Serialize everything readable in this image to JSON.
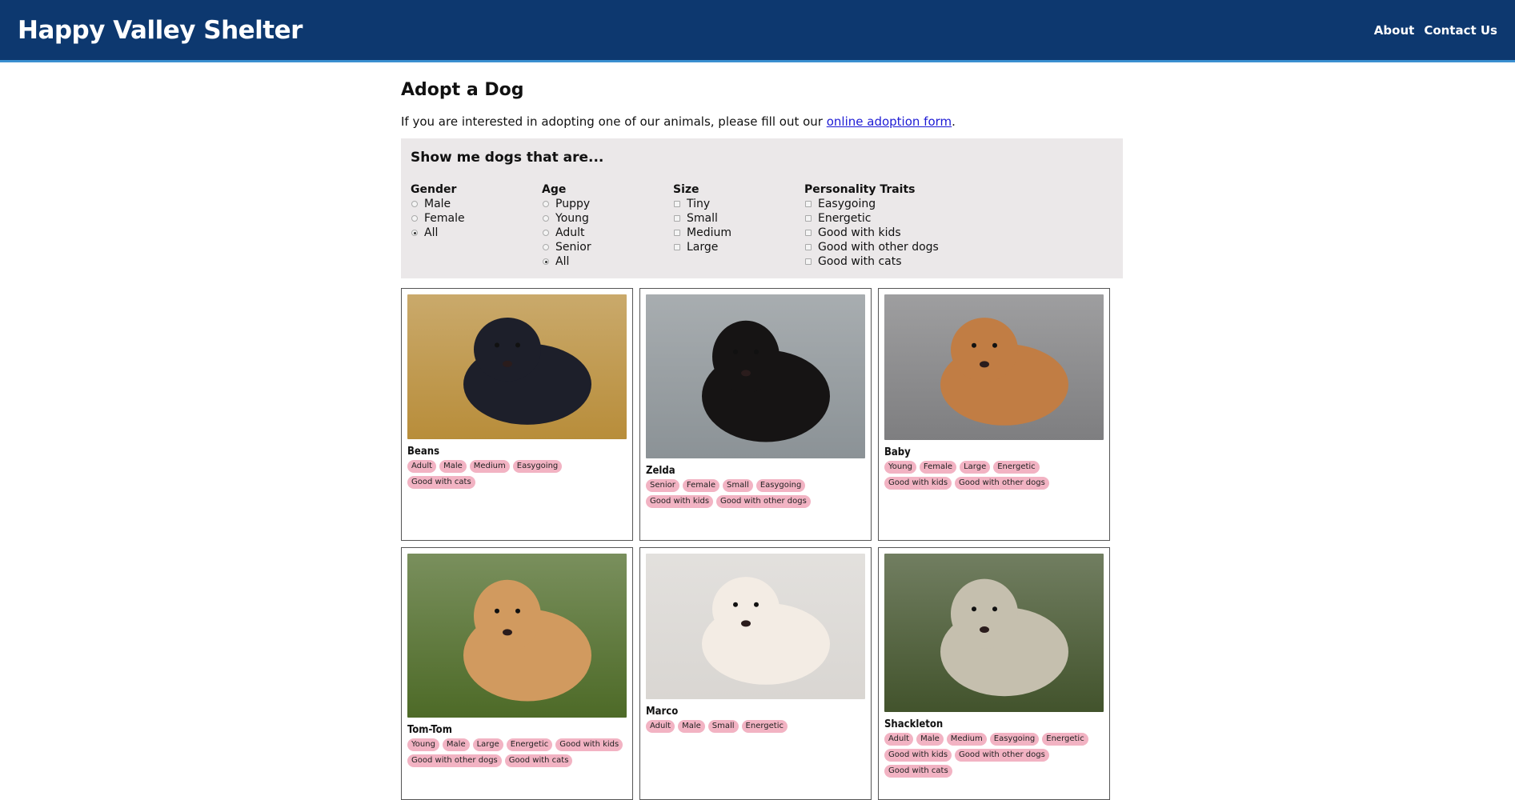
{
  "header": {
    "title": "Happy Valley Shelter",
    "nav": [
      "About",
      "Contact Us"
    ]
  },
  "page": {
    "heading": "Adopt a Dog",
    "intro_before": "If you are interested in adopting one of our animals, please fill out our ",
    "intro_link": "online adoption form",
    "intro_after": "."
  },
  "filters": {
    "heading": "Show me dogs that are...",
    "gender": {
      "title": "Gender",
      "options": [
        "Male",
        "Female",
        "All"
      ],
      "selected": "All"
    },
    "age": {
      "title": "Age",
      "options": [
        "Puppy",
        "Young",
        "Adult",
        "Senior",
        "All"
      ],
      "selected": "All"
    },
    "size": {
      "title": "Size",
      "options": [
        "Tiny",
        "Small",
        "Medium",
        "Large"
      ]
    },
    "traits": {
      "title": "Personality Traits",
      "options": [
        "Easygoing",
        "Energetic",
        "Good with kids",
        "Good with other dogs",
        "Good with cats"
      ]
    }
  },
  "dogs": [
    {
      "name": "Beans",
      "tags": [
        "Adult",
        "Male",
        "Medium",
        "Easygoing",
        "Good with cats"
      ],
      "colors": [
        "#b88d3a",
        "#1d1f2a"
      ]
    },
    {
      "name": "Zelda",
      "tags": [
        "Senior",
        "Female",
        "Small",
        "Easygoing",
        "Good with kids",
        "Good with other dogs"
      ],
      "colors": [
        "#8b9296",
        "#161414"
      ]
    },
    {
      "name": "Baby",
      "tags": [
        "Young",
        "Female",
        "Large",
        "Energetic",
        "Good with kids",
        "Good with other dogs"
      ],
      "colors": [
        "#7e7e80",
        "#c17d44"
      ]
    },
    {
      "name": "Tom-Tom",
      "tags": [
        "Young",
        "Male",
        "Large",
        "Energetic",
        "Good with kids",
        "Good with other dogs",
        "Good with cats"
      ],
      "colors": [
        "#4d6a27",
        "#d19a5f"
      ]
    },
    {
      "name": "Marco",
      "tags": [
        "Adult",
        "Male",
        "Small",
        "Energetic"
      ],
      "colors": [
        "#d9d6d2",
        "#f3ece4"
      ]
    },
    {
      "name": "Shackleton",
      "tags": [
        "Adult",
        "Male",
        "Medium",
        "Easygoing",
        "Energetic",
        "Good with kids",
        "Good with other dogs",
        "Good with cats"
      ],
      "colors": [
        "#42532c",
        "#c5bfae"
      ]
    }
  ]
}
